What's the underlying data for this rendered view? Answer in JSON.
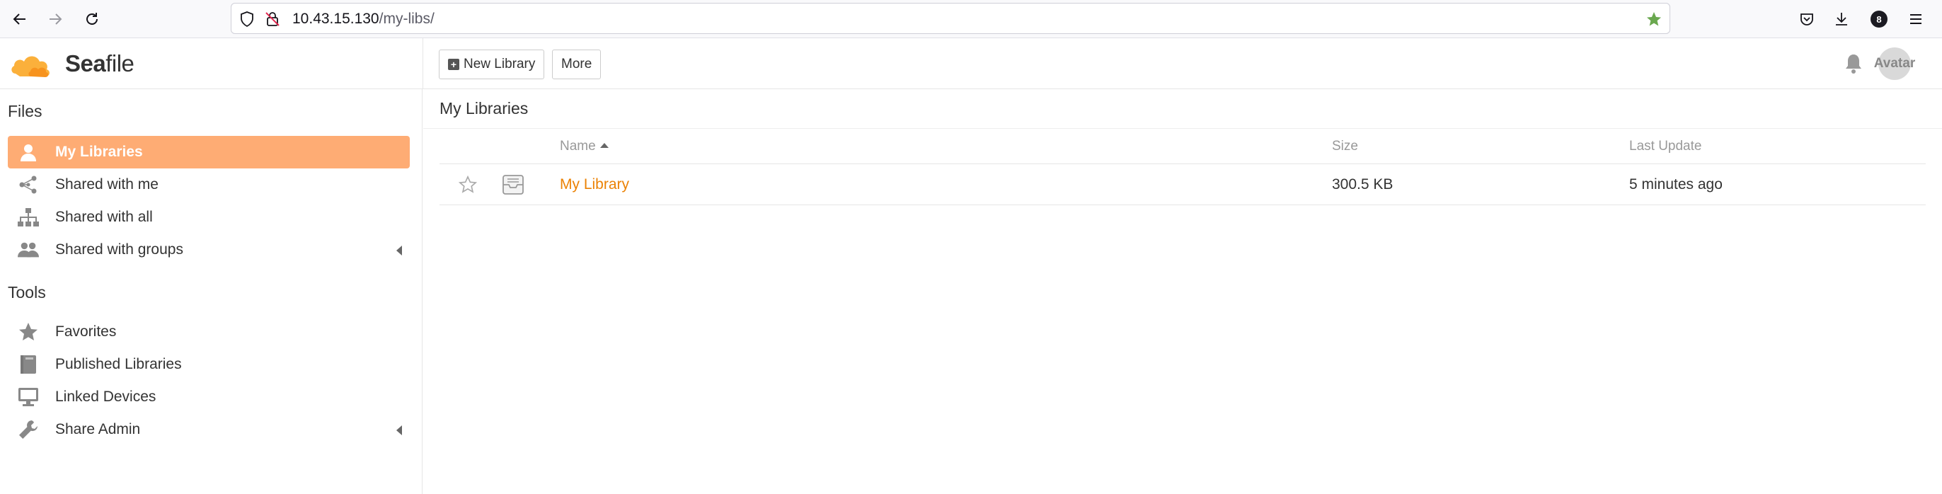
{
  "browser": {
    "url_host": "10.43.15.130",
    "url_path": "/my-libs/",
    "download_badge": "8"
  },
  "app": {
    "logo_bold": "Sea",
    "logo_rest": "file",
    "new_library_label": "New Library",
    "more_label": "More",
    "avatar_label": "Avatar"
  },
  "sidebar": {
    "files_title": "Files",
    "files_items": [
      {
        "label": "My Libraries",
        "icon": "user-icon"
      },
      {
        "label": "Shared with me",
        "icon": "share-icon"
      },
      {
        "label": "Shared with all",
        "icon": "org-icon"
      },
      {
        "label": "Shared with groups",
        "icon": "group-icon"
      }
    ],
    "tools_title": "Tools",
    "tools_items": [
      {
        "label": "Favorites",
        "icon": "star-icon"
      },
      {
        "label": "Published Libraries",
        "icon": "book-icon"
      },
      {
        "label": "Linked Devices",
        "icon": "monitor-icon"
      },
      {
        "label": "Share Admin",
        "icon": "wrench-icon"
      }
    ]
  },
  "main": {
    "title": "My Libraries",
    "columns": {
      "name": "Name",
      "size": "Size",
      "last_update": "Last Update"
    },
    "rows": [
      {
        "name": "My Library",
        "size": "300.5 KB",
        "last_update": "5 minutes ago"
      }
    ]
  },
  "colors": {
    "accent": "#feac74",
    "link": "#eb8205"
  }
}
